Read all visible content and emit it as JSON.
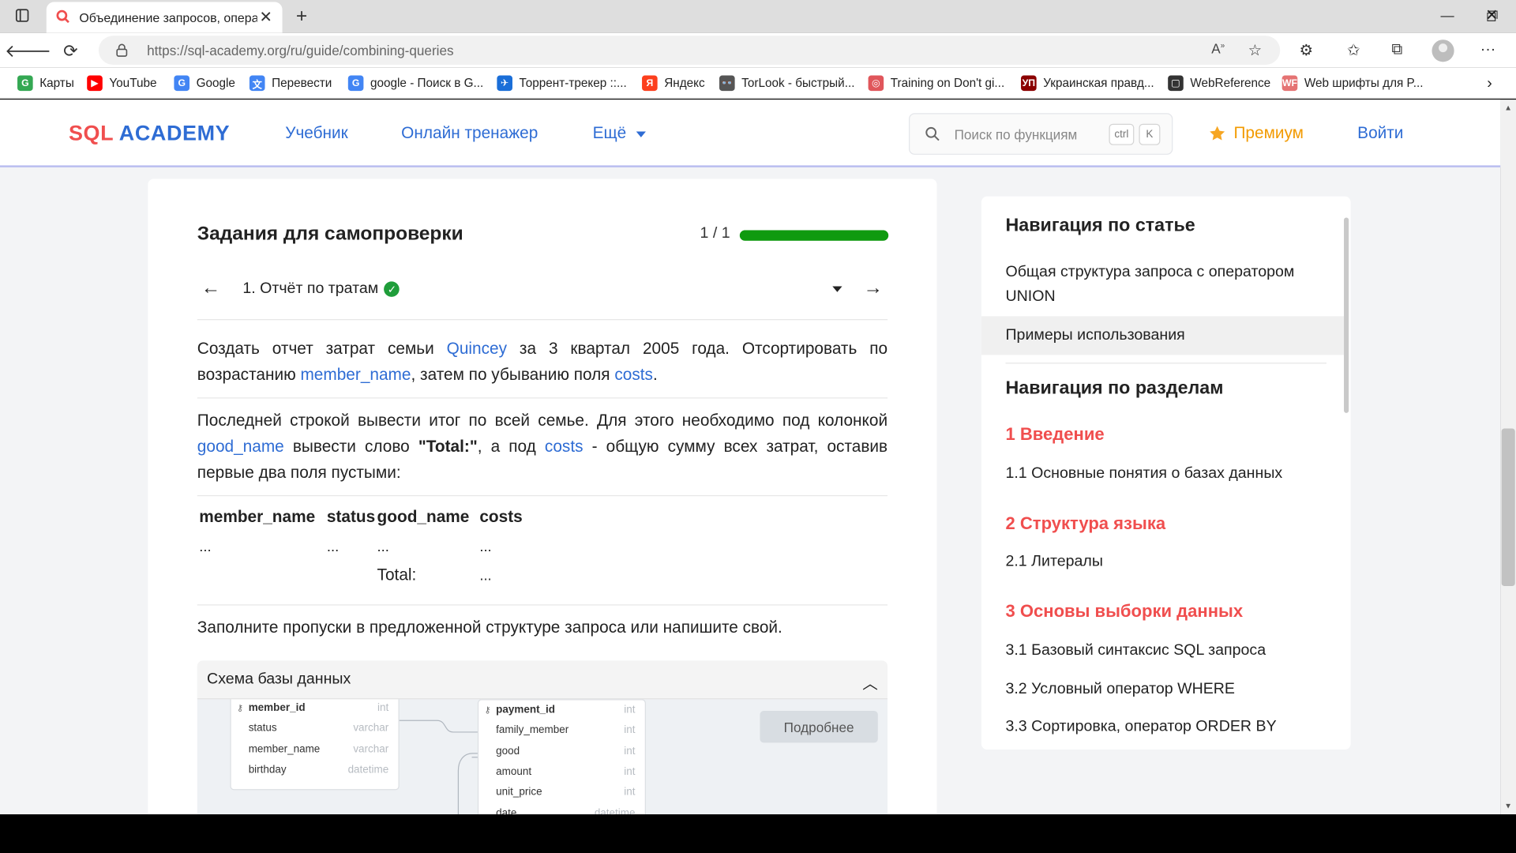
{
  "browser": {
    "tab_title": "Объединение запросов, опера",
    "url": "https://sql-academy.org/ru/guide/combining-queries",
    "bookmarks": [
      {
        "label": "Карты",
        "color": "#34a853"
      },
      {
        "label": "YouTube",
        "color": "#ff0000"
      },
      {
        "label": "Google",
        "color": "#4285f4"
      },
      {
        "label": "Перевести",
        "color": "#4285f4"
      },
      {
        "label": "google - Поиск в G...",
        "color": "#4285f4"
      },
      {
        "label": "Торрент-трекер ::...",
        "color": "#1a6ed8"
      },
      {
        "label": "Яндекс",
        "color": "#fc3f1d"
      },
      {
        "label": "TorLook - быстрый...",
        "color": "#555555"
      },
      {
        "label": "Training on Don't gi...",
        "color": "#e0565b"
      },
      {
        "label": "Украинская правд...",
        "color": "#8b0000"
      },
      {
        "label": "WebReference",
        "color": "#333333"
      },
      {
        "label": "Web шрифты для P...",
        "color": "#e57373"
      }
    ],
    "bookmark_icons": [
      "G",
      "▶",
      "G",
      "文",
      "G",
      "✈",
      "Я",
      "👓",
      "◎",
      "УП",
      "▢",
      "WF"
    ]
  },
  "header": {
    "logo_sql": "SQL",
    "logo_academy": "ACADEMY",
    "nav": [
      "Учебник",
      "Онлайн тренажер",
      "Ещё"
    ],
    "search_placeholder": "Поиск по функциям",
    "kbd_ctrl": "ctrl",
    "kbd_k": "K",
    "premium": "Премиум",
    "login": "Войти"
  },
  "task": {
    "section_title": "Задания для самопроверки",
    "progress_text": "1 / 1",
    "progress_fraction": 1.0,
    "task_name": "1. Отчёт по тратам",
    "p1_a": "Создать отчет затрат семьи ",
    "p1_h1": "Quincey",
    "p1_b": " за 3 квартал 2005 года. Отсортировать по возрастанию ",
    "p1_h2": "member_name",
    "p1_c": ", затем по убыванию поля ",
    "p1_h3": "costs",
    "p1_d": ".",
    "p2_a": "Последней строкой вывести итог по всей семье. Для этого необходимо под колонкой ",
    "p2_h1": "good_name",
    "p2_b": " вывести слово ",
    "p2_bold": "\"Total:\"",
    "p2_c": ", а под ",
    "p2_h2": "costs",
    "p2_d": " - общую сумму всех затрат, оставив первые два поля пустыми:",
    "result_headers": [
      "member_name",
      "status",
      "good_name",
      "costs"
    ],
    "row1": [
      "...",
      "...",
      "...",
      "..."
    ],
    "row2": [
      "Total:",
      "..."
    ],
    "p3": "Заполните пропуски в предложенной структуре запроса или напишите свой."
  },
  "schema": {
    "title": "Схема базы данных",
    "more_button": "Подробнее",
    "family_members": [
      {
        "name": "member_id",
        "type": "int",
        "pk": true
      },
      {
        "name": "status",
        "type": "varchar"
      },
      {
        "name": "member_name",
        "type": "varchar"
      },
      {
        "name": "birthday",
        "type": "datetime"
      }
    ],
    "payments": [
      {
        "name": "payment_id",
        "type": "int",
        "pk": true
      },
      {
        "name": "family_member",
        "type": "int"
      },
      {
        "name": "good",
        "type": "int"
      },
      {
        "name": "amount",
        "type": "int"
      },
      {
        "name": "unit_price",
        "type": "int"
      },
      {
        "name": "date",
        "type": "datetime"
      }
    ]
  },
  "sidebar": {
    "article_nav_title": "Навигация по статье",
    "article_links": [
      "Общая структура запроса с оператором UNION",
      "Примеры использования"
    ],
    "sections_title": "Навигация по разделам",
    "sections": [
      {
        "title": "1 Введение",
        "items": [
          "1.1 Основные понятия о базах данных"
        ]
      },
      {
        "title": "2 Структура языка",
        "items": [
          "2.1 Литералы"
        ]
      },
      {
        "title": "3 Основы выборки данных",
        "items": [
          "3.1 Базовый синтаксис SQL запроса",
          "3.2 Условный оператор WHERE",
          "3.3 Сортировка, оператор ORDER BY"
        ]
      }
    ]
  }
}
